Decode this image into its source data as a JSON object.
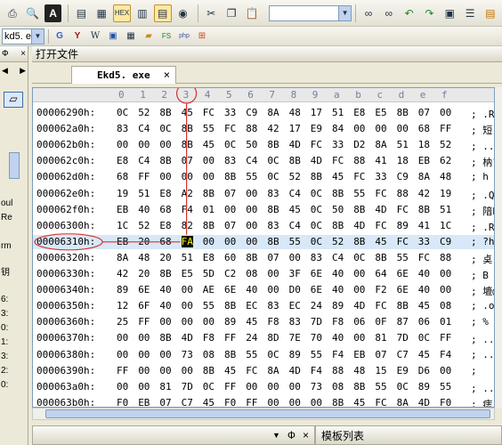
{
  "toolbar1": {
    "icons": [
      "print-icon",
      "find-icon",
      "font-icon",
      "document-icon",
      "document-lines-icon",
      "hex-mode-icon",
      "columns-icon",
      "document-view-icon",
      "globe-icon",
      "cut-icon",
      "copy-icon",
      "paste-icon"
    ],
    "search_value": "",
    "right_icons": [
      "binoculars-icon",
      "binoculars-next-icon",
      "undo-arrow-icon",
      "redo-arrow-icon",
      "macro-icon",
      "list-icon",
      "note-icon"
    ]
  },
  "toolbar2": {
    "file_selector": "kd5. e",
    "icons": [
      "google-icon",
      "yahoo-icon",
      "wikipedia-icon",
      "web-icon",
      "calendar-icon",
      "folder-icon",
      "php-icon",
      "php-doc-icon",
      "windows-icon"
    ]
  },
  "left_panel": {
    "pin": "Ф",
    "labels": [
      "oul",
      "Re",
      "rm",
      "钥",
      "6:",
      "3:",
      "0:",
      "1:",
      "3:",
      "2:",
      "0:"
    ]
  },
  "main": {
    "title": "打开文件",
    "tab_label": "Ekd5. exe",
    "tab_close": "×",
    "column_headers": [
      "0",
      "1",
      "2",
      "3",
      "4",
      "5",
      "6",
      "7",
      "8",
      "9",
      "a",
      "b",
      "c",
      "d",
      "e",
      "f"
    ],
    "rows": [
      {
        "addr": "00006290h:",
        "bytes": [
          "0C",
          "52",
          "8B",
          "45",
          "FC",
          "33",
          "C9",
          "8A",
          "48",
          "17",
          "51",
          "E8",
          "E5",
          "8B",
          "07",
          "00"
        ],
        "text": "; .R媥"
      },
      {
        "addr": "000062a0h:",
        "bytes": [
          "83",
          "C4",
          "0C",
          "8B",
          "55",
          "FC",
          "88",
          "42",
          "17",
          "E9",
          "84",
          "00",
          "00",
          "00",
          "68",
          "FF"
        ],
        "text": "; 短.媇"
      },
      {
        "addr": "000062b0h:",
        "bytes": [
          "00",
          "00",
          "00",
          "8B",
          "45",
          "0C",
          "50",
          "8B",
          "4D",
          "FC",
          "33",
          "D2",
          "8A",
          "51",
          "18",
          "52"
        ],
        "text": "; ...媊"
      },
      {
        "addr": "000062c0h:",
        "bytes": [
          "E8",
          "C4",
          "8B",
          "07",
          "00",
          "83",
          "C4",
          "0C",
          "8B",
          "4D",
          "FC",
          "88",
          "41",
          "18",
          "EB",
          "62"
        ],
        "text": "; 枘?.."
      },
      {
        "addr": "000062d0h:",
        "bytes": [
          "68",
          "FF",
          "00",
          "00",
          "00",
          "8B",
          "55",
          "0C",
          "52",
          "8B",
          "45",
          "FC",
          "33",
          "C9",
          "8A",
          "48"
        ],
        "text": "; h  ."
      },
      {
        "addr": "000062e0h:",
        "bytes": [
          "19",
          "51",
          "E8",
          "A2",
          "8B",
          "07",
          "00",
          "83",
          "C4",
          "0C",
          "8B",
          "55",
          "FC",
          "88",
          "42",
          "19"
        ],
        "text": "; .Q锯"
      },
      {
        "addr": "000062f0h:",
        "bytes": [
          "EB",
          "40",
          "68",
          "F4",
          "01",
          "00",
          "00",
          "8B",
          "45",
          "0C",
          "50",
          "8B",
          "4D",
          "FC",
          "8B",
          "51"
        ],
        "text": "; 隌h?"
      },
      {
        "addr": "00006300h:",
        "bytes": [
          "1C",
          "52",
          "E8",
          "82",
          "8B",
          "07",
          "00",
          "83",
          "C4",
          "0C",
          "8B",
          "4D",
          "FC",
          "89",
          "41",
          "1C"
        ],
        "text": "; .R鑲"
      },
      {
        "addr": "00006310h:",
        "bytes": [
          "EB",
          "20",
          "68",
          "FA",
          "00",
          "00",
          "00",
          "8B",
          "55",
          "0C",
          "52",
          "8B",
          "45",
          "FC",
          "33",
          "C9"
        ],
        "text": "; ?h?."
      },
      {
        "addr": "00006320h:",
        "bytes": [
          "8A",
          "48",
          "20",
          "51",
          "E8",
          "60",
          "8B",
          "07",
          "00",
          "83",
          "C4",
          "0C",
          "8B",
          "55",
          "FC",
          "88"
        ],
        "text": "; 奌 Q"
      },
      {
        "addr": "00006330h:",
        "bytes": [
          "42",
          "20",
          "8B",
          "E5",
          "5D",
          "C2",
          "08",
          "00",
          "3F",
          "6E",
          "40",
          "00",
          "64",
          "6E",
          "40",
          "00"
        ],
        "text": "; B 嬪]"
      },
      {
        "addr": "00006340h:",
        "bytes": [
          "89",
          "6E",
          "40",
          "00",
          "AE",
          "6E",
          "40",
          "00",
          "D0",
          "6E",
          "40",
          "00",
          "F2",
          "6E",
          "40",
          "00"
        ],
        "text": "; 塶@."
      },
      {
        "addr": "00006350h:",
        "bytes": [
          "12",
          "6F",
          "40",
          "00",
          "55",
          "8B",
          "EC",
          "83",
          "EC",
          "24",
          "89",
          "4D",
          "FC",
          "8B",
          "45",
          "08"
        ],
        "text": "; .o@.U"
      },
      {
        "addr": "00006360h:",
        "bytes": [
          "25",
          "FF",
          "00",
          "00",
          "00",
          "89",
          "45",
          "F8",
          "83",
          "7D",
          "F8",
          "06",
          "0F",
          "87",
          "06",
          "01"
        ],
        "text": "; %  ."
      },
      {
        "addr": "00006370h:",
        "bytes": [
          "00",
          "00",
          "8B",
          "4D",
          "F8",
          "FF",
          "24",
          "8D",
          "7E",
          "70",
          "40",
          "00",
          "81",
          "7D",
          "0C",
          "FF"
        ],
        "text": "; ..婱"
      },
      {
        "addr": "00006380h:",
        "bytes": [
          "00",
          "00",
          "00",
          "73",
          "08",
          "8B",
          "55",
          "0C",
          "89",
          "55",
          "F4",
          "EB",
          "07",
          "C7",
          "45",
          "F4"
        ],
        "text": "; ...s"
      },
      {
        "addr": "00006390h:",
        "bytes": [
          "FF",
          "00",
          "00",
          "00",
          "8B",
          "45",
          "FC",
          "8A",
          "4D",
          "F4",
          "88",
          "48",
          "15",
          "E9",
          "D6",
          "00"
        ],
        "text": ";    ."
      },
      {
        "addr": "000063a0h:",
        "bytes": [
          "00",
          "00",
          "81",
          "7D",
          "0C",
          "FF",
          "00",
          "00",
          "00",
          "73",
          "08",
          "8B",
          "55",
          "0C",
          "89",
          "55"
        ],
        "text": "; ..亇"
      },
      {
        "addr": "000063b0h:",
        "bytes": [
          "F0",
          "EB",
          "07",
          "C7",
          "45",
          "F0",
          "FF",
          "00",
          "00",
          "00",
          "8B",
          "45",
          "FC",
          "8A",
          "4D",
          "F0"
        ],
        "text": "; 痣.荅"
      }
    ],
    "highlight_row": 8,
    "cursor_col": 3,
    "circled_col": 3
  },
  "bottom": {
    "pin": "Ф",
    "close": "×",
    "right_title": "模板列表"
  },
  "colors": {
    "accent": "#c1d2ee",
    "annotation": "#d83030",
    "highlight": "#d8e8f8"
  }
}
